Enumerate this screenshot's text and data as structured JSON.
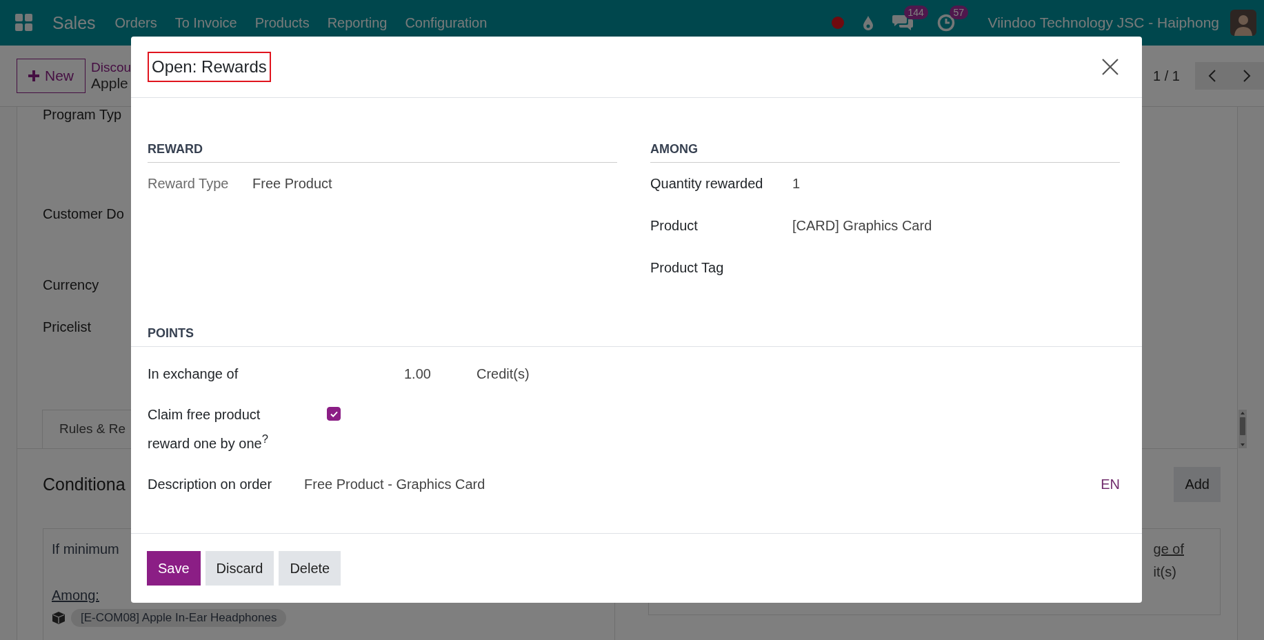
{
  "navbar": {
    "app": "Sales",
    "menu": [
      "Orders",
      "To Invoice",
      "Products",
      "Reporting",
      "Configuration"
    ],
    "messages_count": "144",
    "activities_count": "57",
    "company": "Viindoo Technology JSC - Haiphong"
  },
  "control_panel": {
    "new_button": "New",
    "breadcrumb": "Discou",
    "record": "Apple",
    "pager": "1 / 1"
  },
  "background_form": {
    "fields": [
      "Program Typ",
      "Customer Do",
      "Currency",
      "Pricelist"
    ],
    "tab": "Rules & Re",
    "section_title": "Conditiona",
    "add_button": "Add",
    "rule_text": "If minimum",
    "among_label": "Among:",
    "product_tag": "[E-COM08] Apple In-Ear Headphones",
    "right_link": "ge of",
    "right_text": "it(s)"
  },
  "dialog": {
    "title": "Open: Rewards",
    "sections": [
      {
        "heading": "REWARD",
        "fields": [
          {
            "label": "Reward Type",
            "value": "Free Product"
          }
        ]
      },
      {
        "heading": "AMONG",
        "fields": [
          {
            "label": "Quantity rewarded",
            "value": "1"
          },
          {
            "label": "Product",
            "value": "[CARD] Graphics Card"
          },
          {
            "label": "Product Tag"
          }
        ]
      }
    ],
    "points": {
      "heading": "POINTS",
      "exchange": {
        "label": "In exchange of",
        "value": "1.00",
        "unit": "Credit(s)"
      },
      "claim": {
        "label": "Claim free product reward one by one$^{?}$",
        "checked": true
      },
      "description": {
        "label": "Description on order",
        "value": "Free Product - Graphics Card",
        "lang": "EN"
      }
    },
    "buttons": [
      {
        "label": "Save",
        "kind": "primary"
      },
      {
        "label": "Discard",
        "kind": "secondary"
      },
      {
        "label": "Delete",
        "kind": "secondary"
      }
    ]
  }
}
